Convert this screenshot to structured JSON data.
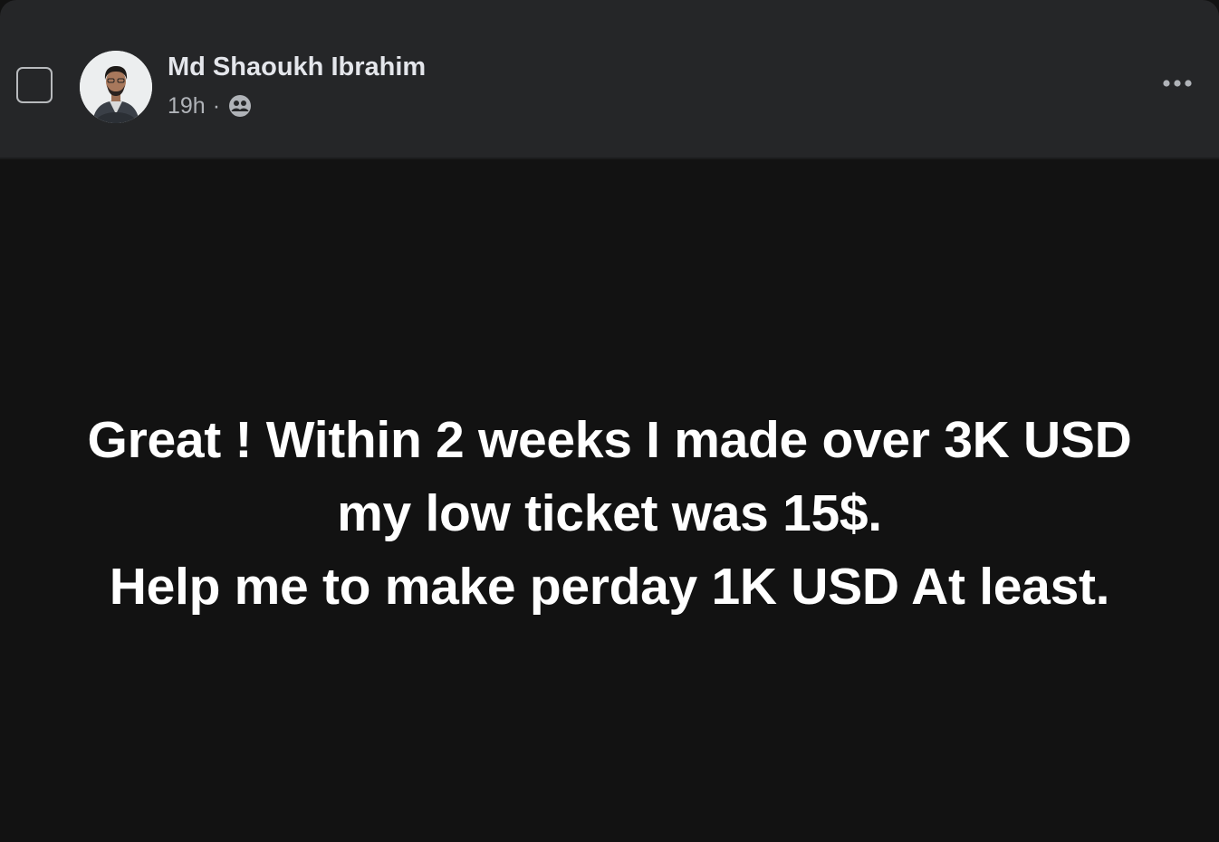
{
  "post": {
    "author": {
      "name": "Md Shaoukh Ibrahim"
    },
    "time": "19h",
    "separator": "·",
    "audience_icon": "friends-icon",
    "more_icon": "more-options-icon",
    "text_lines": [
      "Great ! Within 2 weeks I made over 3K USD",
      "my low ticket was 15$.",
      "Help me to make perday 1K USD At least."
    ]
  },
  "colors": {
    "header_bg": "#252628",
    "body_bg": "#121212",
    "name_text": "#e4e6eb",
    "meta_text": "#b0b3b8",
    "post_text": "#ffffff"
  }
}
